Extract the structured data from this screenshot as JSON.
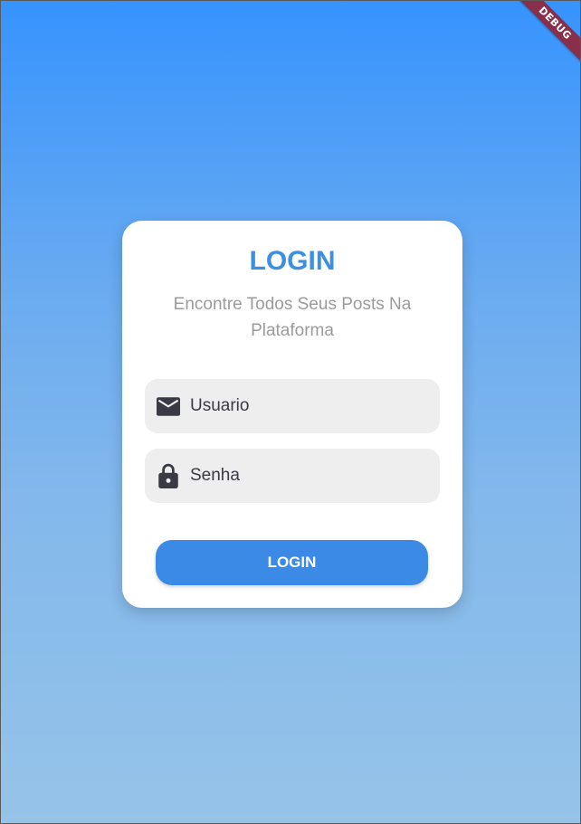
{
  "debug_banner": {
    "label": "DEBUG"
  },
  "login_card": {
    "title": "LOGIN",
    "subtitle": "Encontre Todos Seus Posts Na Plataforma",
    "username_field": {
      "placeholder": "Usuario",
      "icon": "mail-icon"
    },
    "password_field": {
      "placeholder": "Senha",
      "icon": "lock-icon"
    },
    "login_button_label": "LOGIN"
  },
  "colors": {
    "gradient_top": "#3693fe",
    "gradient_bottom": "#96c3e8",
    "accent": "#3d8fe4",
    "button": "#3b8be6",
    "field_bg": "#eeeeee",
    "debug_ribbon": "#8a2f4a"
  }
}
